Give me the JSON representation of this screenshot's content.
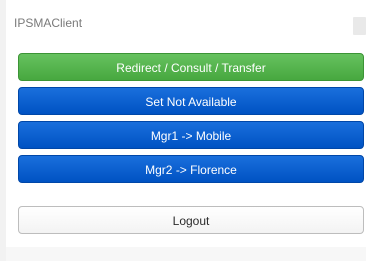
{
  "window": {
    "title": "IPSMAClient"
  },
  "actions": {
    "redirect_label": "Redirect / Consult / Transfer",
    "not_available_label": "Set Not Available",
    "mgr1_label": "Mgr1 -> Mobile",
    "mgr2_label": "Mgr2 -> Florence",
    "logout_label": "Logout"
  },
  "colors": {
    "redirect": "#4fb046",
    "primary": "#0a5ed2",
    "logout": "#f7f7f7"
  }
}
